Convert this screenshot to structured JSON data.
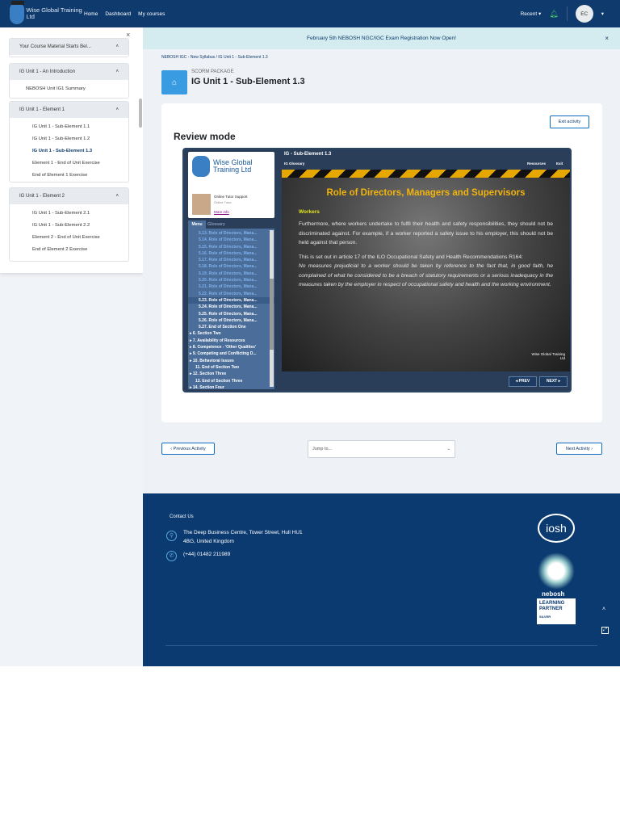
{
  "nav": {
    "brand": "Wise Global Training Ltd",
    "links": [
      "Home",
      "Dashboard",
      "My courses"
    ],
    "recent": "Recent",
    "user_initials": "EC"
  },
  "banner": {
    "text": "February 5th NEBOSH NGC/IGC Exam Registration Now Open!"
  },
  "breadcrumb": "NEBOSH IGC - New Syllabus / IG Unit 1 - Sub-Element 1.3",
  "header": {
    "type": "SCORM PACKAGE",
    "title": "IG Unit 1 - Sub-Element 1.3"
  },
  "sidebar": {
    "sections": [
      {
        "title": "Your Course Material Starts Bel...",
        "items": []
      },
      {
        "title": "IG Unit 1 - An Introduction",
        "items": [
          "NEBOSH Unit IG1 Summary"
        ]
      },
      {
        "title": "IG Unit 1 - Element 1",
        "items": [
          "IG Unit 1 - Sub-Element 1.1",
          "IG Unit 1 - Sub-Element 1.2",
          "IG Unit 1 - Sub-Element 1.3",
          "Element 1 - End of Unit Exercise",
          "End of Element 1 Exercise"
        ]
      },
      {
        "title": "IG Unit 1 - Element 2",
        "items": [
          "IG Unit 1 - Sub-Element 2.1",
          "IG Unit 1 - Sub-Element 2.2",
          "Element 2 - End of Unit Exercise",
          "End of Element 2 Exercise"
        ]
      }
    ]
  },
  "activity": {
    "mode": "Review mode",
    "exit": "Exit activity"
  },
  "player": {
    "title": "IG - Sub-Element 1.3",
    "glossary_link": "IG Glossary",
    "resources": "Resources",
    "exit": "Exit",
    "brand": "Wise Global Training Ltd",
    "tutor_name": "Online Tutor Support",
    "tutor_role": "Online Tutor",
    "more_info": "More info",
    "tabs": [
      "Menu",
      "Glossary"
    ],
    "menu": [
      "5.13. Role of Directors, Mana...",
      "5.14. Role of Directors, Mana...",
      "5.15. Role of Directors, Mana...",
      "5.16. Role of Directors, Mana...",
      "5.17. Role of Directors, Mana...",
      "5.18. Role of Directors, Mana...",
      "5.19. Role of Directors, Mana...",
      "5.20. Role of Directors, Mana...",
      "5.21. Role of Directors, Mana...",
      "5.22. Role of Directors, Mana...",
      "5.23. Role of Directors, Mana...",
      "5.24. Role of Directors, Mana...",
      "5.25. Role of Directors, Mana...",
      "5.26. Role of Directors, Mana...",
      "5.27. End of Section One",
      "6. Section Two",
      "7. Availability of Resources",
      "8. Competence - 'Other Qualities'",
      "9. Competing and Conflicting D...",
      "10. Behavioral Issues",
      "11. End of Section Two",
      "12. Section Three",
      "13. End of Section Three",
      "14. Section Four"
    ],
    "slide_title": "Role of Directors, Managers and Supervisors",
    "subheading": "Workers",
    "para1": "Furthermore, where workers undertake to fulfil their health and safety responsibilities, they should not be discriminated against.  For example, if a worker reported a safety issue to his employer, this should not be held against that person.",
    "para2": "This is set out in article 17 of the ILO Occupational Safety and Health Recommendations R164:",
    "quote": "No measures prejudicial to a worker should be taken by reference to the fact that, in good faith, he complained of what he considered to be a breach of statutory requirements or a serious inadequacy in the measures taken by the employer in respect of occupational safety and health and the working environment.",
    "prev": "◂ PREV",
    "next": "NEXT ▸"
  },
  "navigation": {
    "prev": "Previous Activity",
    "jump": "Jump to...",
    "next": "Next Activity"
  },
  "footer": {
    "contact_title": "Contact Us",
    "address": "The Deep Business Centre, Tower Street, Hull HU1 4BG, United Kingdom",
    "phone": "(+44) 01482 211989",
    "iosh": "iosh",
    "nebosh": "nebosh",
    "partner": "LEARNING PARTNER",
    "level": "SILVER"
  }
}
